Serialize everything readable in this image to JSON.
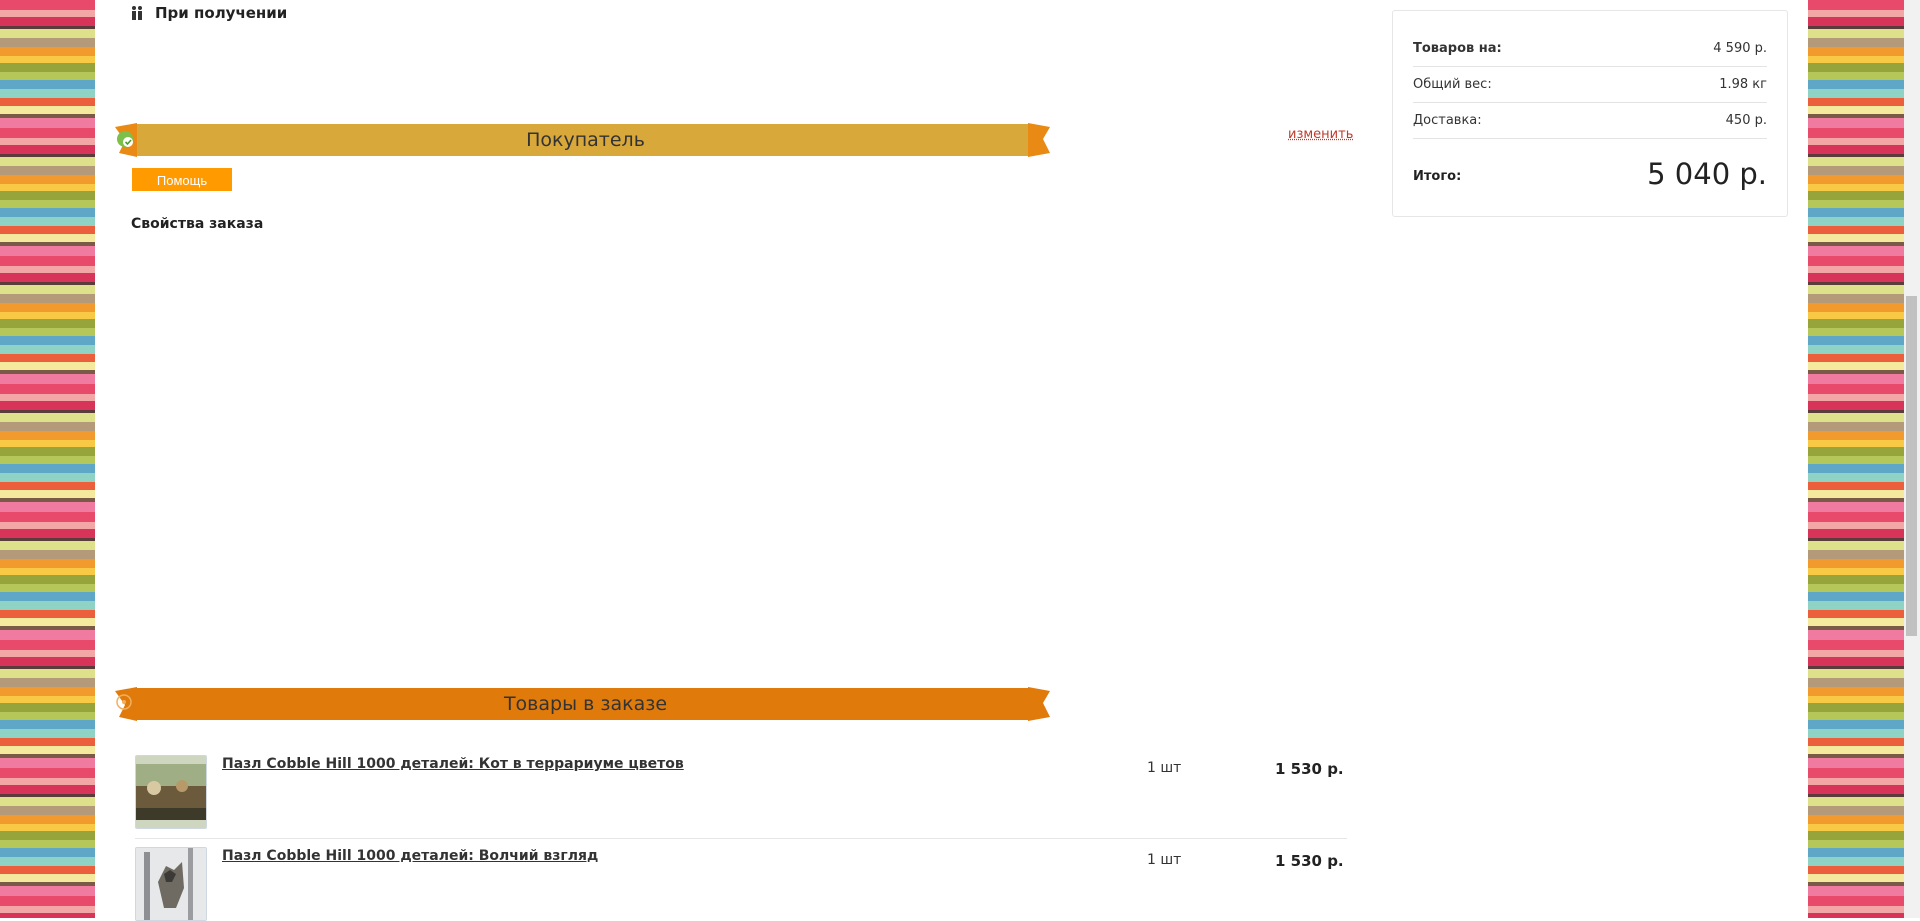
{
  "payment": {
    "label": "При получении",
    "icon": "hand-payment-icon"
  },
  "sections": {
    "buyer": {
      "title": "Покупатель",
      "edit_label": "изменить",
      "icon": "check-badge-icon"
    },
    "help_label": "Помощь",
    "order_props_title": "Свойства заказа",
    "goods": {
      "title": "Товары в заказе",
      "icon": "circle-icon"
    }
  },
  "items": [
    {
      "name": "Пазл Cobble Hill 1000 деталей: Кот в террариуме цветов",
      "qty": "1 шт",
      "price": "1 530 р."
    },
    {
      "name": "Пазл Cobble Hill 1000 деталей: Волчий взгляд",
      "qty": "1 шт",
      "price": "1 530 р."
    }
  ],
  "summary": {
    "goods_label": "Товаров на:",
    "goods_value": "4 590 р.",
    "weight_label": "Общий вес:",
    "weight_value": "1.98 кг",
    "delivery_label": "Доставка:",
    "delivery_value": "450 р.",
    "total_label": "Итого:",
    "total_value": "5 040 р."
  },
  "colors": {
    "buyer_banner": "#d9a83a",
    "goods_banner": "#e07b0b",
    "banner_edge": "#e88a14",
    "help_button": "#ff9a00",
    "link": "#c0392b"
  }
}
